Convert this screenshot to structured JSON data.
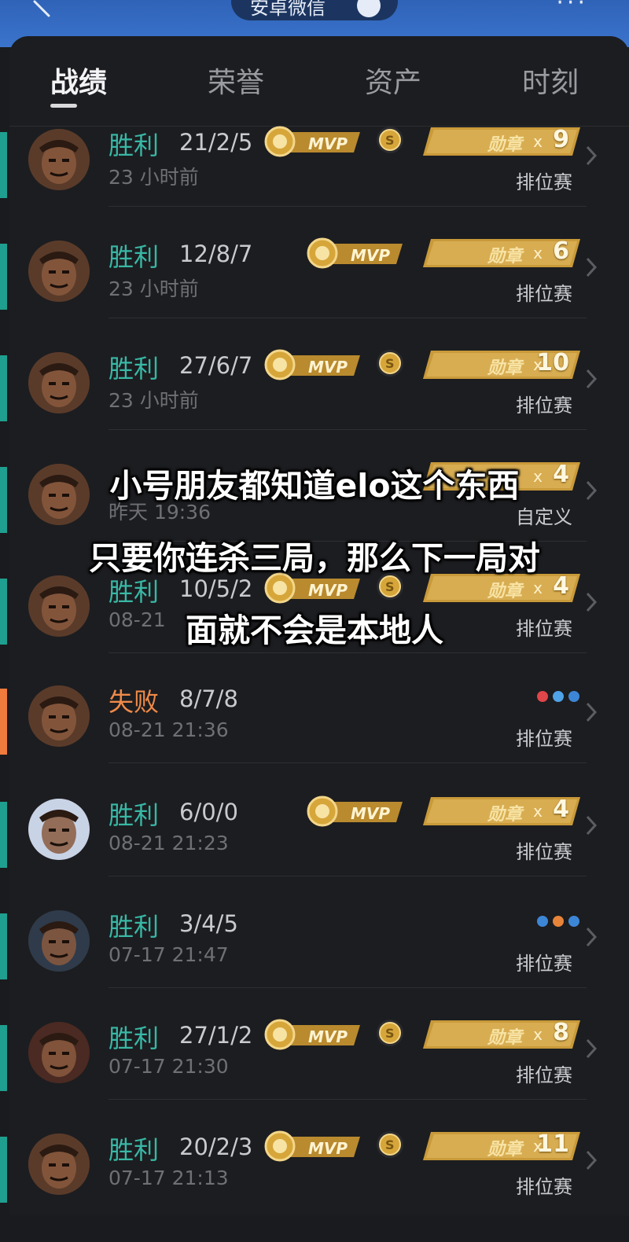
{
  "header": {
    "server_label": "安卓微信",
    "more_label": "···"
  },
  "tabs": [
    {
      "label": "战绩",
      "active": true
    },
    {
      "label": "荣誉",
      "active": false
    },
    {
      "label": "资产",
      "active": false
    },
    {
      "label": "时刻",
      "active": false
    }
  ],
  "matches": [
    {
      "result": "胜利",
      "kda": "21/2/5",
      "time": "23 小时前",
      "mode": "排位赛",
      "mvp": true,
      "coin": true,
      "medal_label": "勋章",
      "medal_count": "9",
      "outcome": "win",
      "avatar": "hero-a"
    },
    {
      "result": "胜利",
      "kda": "12/8/7",
      "time": "23 小时前",
      "mode": "排位赛",
      "mvp": true,
      "coin": false,
      "medal_label": "勋章",
      "medal_count": "6",
      "outcome": "win",
      "avatar": "hero-a"
    },
    {
      "result": "胜利",
      "kda": "27/6/7",
      "time": "23 小时前",
      "mode": "排位赛",
      "mvp": true,
      "coin": true,
      "medal_label": "勋章",
      "medal_count": "10",
      "outcome": "win",
      "avatar": "hero-a"
    },
    {
      "result": "",
      "kda": "",
      "time": "昨天 19:36",
      "mode": "自定义",
      "mvp": false,
      "coin": false,
      "medal_label": "",
      "medal_count": "4",
      "outcome": "win",
      "avatar": "hero-a"
    },
    {
      "result": "胜利",
      "kda": "10/5/2",
      "time": "08-21",
      "mode": "排位赛",
      "mvp": true,
      "coin": true,
      "medal_label": "勋章",
      "medal_count": "4",
      "outcome": "win",
      "avatar": "hero-a"
    },
    {
      "result": "失败",
      "kda": "8/7/8",
      "time": "08-21 21:36",
      "mode": "排位赛",
      "mvp": false,
      "coin": false,
      "medal_label": "",
      "medal_count": "",
      "outcome": "loss",
      "avatar": "hero-a"
    },
    {
      "result": "胜利",
      "kda": "6/0/0",
      "time": "08-21 21:23",
      "mode": "排位赛",
      "mvp": true,
      "coin": false,
      "medal_label": "勋章",
      "medal_count": "4",
      "outcome": "win",
      "avatar": "hero-b"
    },
    {
      "result": "胜利",
      "kda": "3/4/5",
      "time": "07-17 21:47",
      "mode": "排位赛",
      "mvp": false,
      "coin": false,
      "medal_label": "",
      "medal_count": "",
      "outcome": "win",
      "avatar": "hero-c"
    },
    {
      "result": "胜利",
      "kda": "27/1/2",
      "time": "07-17 21:30",
      "mode": "排位赛",
      "mvp": true,
      "coin": true,
      "medal_label": "勋章",
      "medal_count": "8",
      "outcome": "win",
      "avatar": "hero-d"
    },
    {
      "result": "胜利",
      "kda": "20/2/3",
      "time": "07-17 21:13",
      "mode": "排位赛",
      "mvp": true,
      "coin": true,
      "medal_label": "勋章",
      "medal_count": "11",
      "outcome": "win",
      "avatar": "hero-a"
    }
  ],
  "badges": {
    "mvp_label": "MVP",
    "coin_label": "S",
    "x_label": "x"
  },
  "overlay_caption": [
    "小号朋友都知道elo这个东西",
    "只要你连杀三局，那么下一局对",
    "面就不会是本地人"
  ],
  "colors": {
    "win": "#38b8a6",
    "loss": "#ef8a49",
    "gold": "#d6a63a",
    "topband": "#3b74cc"
  }
}
